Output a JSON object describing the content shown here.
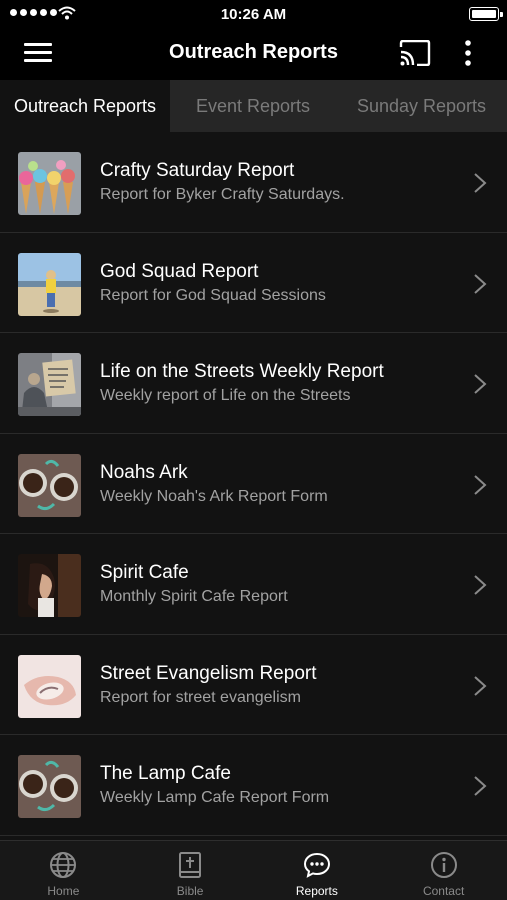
{
  "status": {
    "time": "10:26 AM"
  },
  "nav": {
    "title": "Outreach Reports"
  },
  "tabs": [
    "Outreach Reports",
    "Event Reports",
    "Sunday Reports"
  ],
  "reports": [
    {
      "title": "Crafty Saturday Report",
      "subtitle": "Report for Byker Crafty Saturdays."
    },
    {
      "title": "God Squad Report",
      "subtitle": "Report for God Squad Sessions"
    },
    {
      "title": "Life on the Streets Weekly Report",
      "subtitle": "Weekly report of Life on the Streets"
    },
    {
      "title": "Noahs Ark",
      "subtitle": "Weekly Noah's Ark Report Form"
    },
    {
      "title": "Spirit Cafe",
      "subtitle": "Monthly Spirit Cafe Report"
    },
    {
      "title": "Street Evangelism Report",
      "subtitle": "Report for street evangelism"
    },
    {
      "title": "The Lamp Cafe",
      "subtitle": "Weekly Lamp Cafe Report Form"
    }
  ],
  "tab_bar": {
    "items": [
      {
        "label": "Home",
        "icon": "globe-icon"
      },
      {
        "label": "Bible",
        "icon": "bible-icon"
      },
      {
        "label": "Reports",
        "icon": "chat-bubble-icon"
      },
      {
        "label": "Contact",
        "icon": "info-icon"
      }
    ],
    "active": "Reports"
  },
  "colors": {
    "background": "#121212",
    "inactive_tab": "#262626",
    "subtitle": "#a2a2a2"
  }
}
